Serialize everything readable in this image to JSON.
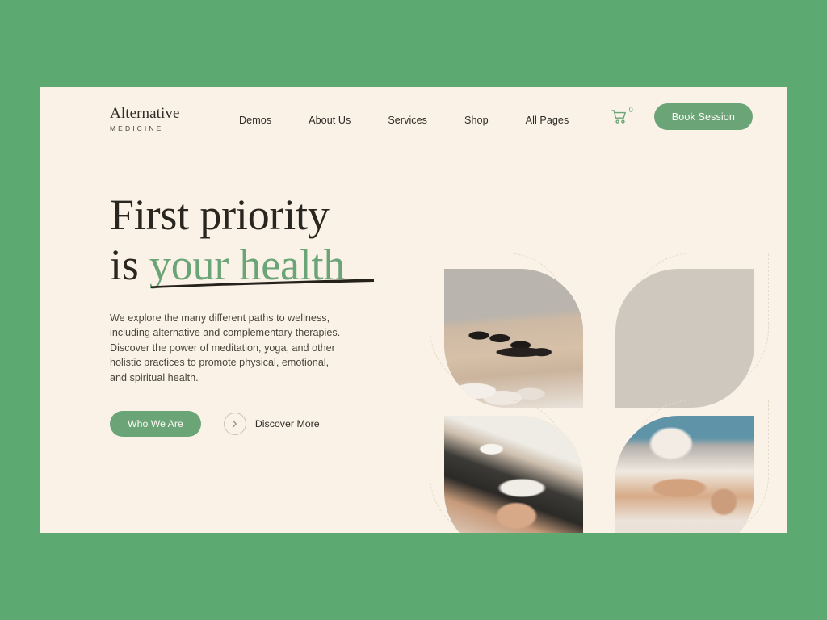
{
  "page": {
    "background_color": "#5da972",
    "card_background_color": "#faf2e7",
    "accent_green": "#6ba477"
  },
  "header": {
    "logo": {
      "main": "Alternative",
      "sub": "MEDICINE"
    },
    "nav": [
      {
        "label": "Demos"
      },
      {
        "label": "About Us"
      },
      {
        "label": "Services"
      },
      {
        "label": "Shop"
      },
      {
        "label": "All Pages"
      }
    ],
    "cart": {
      "icon": "shopping-cart-icon",
      "count": "0"
    },
    "book_button": {
      "label": "Book Session"
    }
  },
  "hero": {
    "headline_line1": "First priority",
    "headline_line2_prefix": "is ",
    "headline_line2_accent": "your health",
    "paragraph": "We explore the many different paths to wellness, including alternative and complementary therapies. Discover the power of meditation, yoga, and other holistic practices to promote physical, emotional, and spiritual health.",
    "primary_button": {
      "label": "Who We Are"
    },
    "secondary_link": {
      "label": "Discover More",
      "icon": "chevron-right-icon"
    }
  },
  "gallery": {
    "tiles": [
      {
        "alt": "hot-stone-massage-photo"
      },
      {
        "alt": "aromatherapy-oil-massage-photo"
      },
      {
        "alt": "facial-treatment-photo"
      },
      {
        "alt": "leg-massage-therapy-photo"
      }
    ]
  }
}
